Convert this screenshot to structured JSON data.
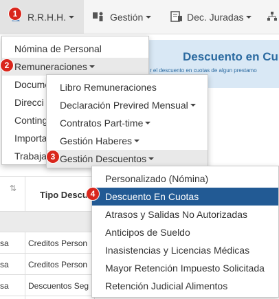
{
  "navbar": {
    "items": [
      {
        "label": "R.R.H.H.",
        "icon": "users-icon"
      },
      {
        "label": "Gestión",
        "icon": "workers-icon"
      },
      {
        "label": "Dec. Juradas",
        "icon": "document-icon"
      }
    ]
  },
  "badges": [
    "1",
    "2",
    "3",
    "4"
  ],
  "page": {
    "banner_title": "Descuento en Cu",
    "banner_subtitle": "r el descuento en cuotas de algun prestamo"
  },
  "table": {
    "header": "Tipo Descu",
    "rows": [
      {
        "c1": "sa",
        "c2": "Creditos Person"
      },
      {
        "c1": "sa",
        "c2": "Creditos Person"
      },
      {
        "c1": "sa",
        "c2": "Descuentos Seg"
      }
    ]
  },
  "menu1": {
    "items": [
      "Nómina de Personal",
      "Remuneraciones",
      "Docume",
      "Direcci",
      "Conting",
      "Importa",
      "Trabaja"
    ]
  },
  "menu2": {
    "items": [
      "Libro Remuneraciones",
      "Declaración Previred Mensual",
      "Contratos Part-time",
      "Gestión Haberes",
      "Gestión Descuentos"
    ]
  },
  "menu3": {
    "items": [
      "Personalizado (Nómina)",
      "Descuento En Cuotas",
      "Atrasos y Salidas No Autorizadas",
      "Anticipos de Sueldo",
      "Inasistencias y Licencias Médicas",
      "Mayor Retención Impuesto Solicitada",
      "Retención Judicial Alimentos"
    ]
  },
  "colors": {
    "badge": "#d9261c",
    "selected": "#225a94",
    "banner": "#d9e8f5"
  }
}
